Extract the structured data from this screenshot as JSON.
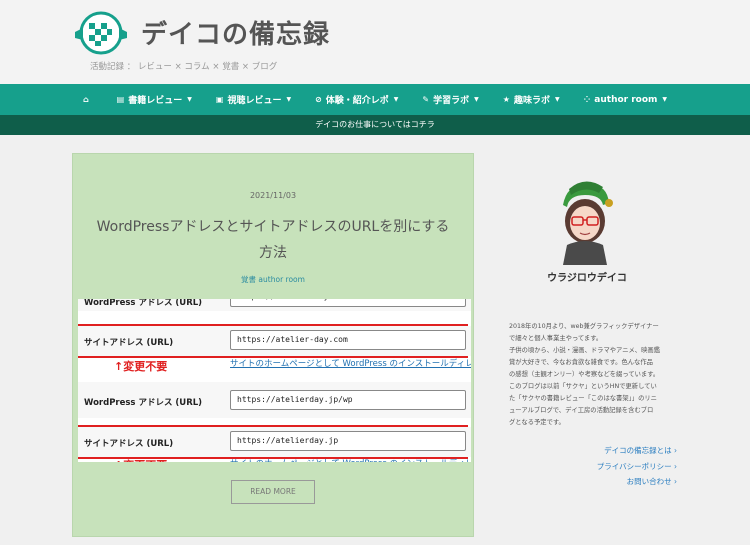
{
  "header": {
    "site_title": "デイコの備忘録",
    "tagline": "活動記録 ： レビュー × コラム × 覚書 × ブログ"
  },
  "nav": {
    "items": [
      {
        "icon": "home-icon",
        "label": ""
      },
      {
        "icon": "book-icon",
        "label": "書籍レビュー"
      },
      {
        "icon": "film-icon",
        "label": "視聴レビュー"
      },
      {
        "icon": "compass-icon",
        "label": "体験・紹介レポ"
      },
      {
        "icon": "pencil-icon",
        "label": "学習ラボ"
      },
      {
        "icon": "star-icon",
        "label": "趣味ラボ"
      },
      {
        "icon": "spinner-icon",
        "label": "author room"
      }
    ]
  },
  "subbar": {
    "text": "デイコのお仕事についてはコチラ"
  },
  "post": {
    "date": "2021/11/03",
    "title": "WordPressアドレスとサイトアドレスのURLを別にする方法",
    "category": "覚書 author room",
    "read_more": "READ MORE"
  },
  "screenshot": {
    "rows": [
      {
        "label": "WordPress アドレス (URL)",
        "value": "https://atelier-day.com"
      },
      {
        "label": "サイトアドレス (URL)",
        "value": "https://atelier-day.com"
      },
      {
        "label": "WordPress アドレス (URL)",
        "value": "https://atelierday.jp/wp"
      },
      {
        "label": "サイトアドレス (URL)",
        "value": "https://atelierday.jp"
      }
    ],
    "help_text": "サイトのホームページとして WordPress のインストールディレクトリとは",
    "note": "↑変更不要"
  },
  "sidebar": {
    "name": "ウラジロウデイコ",
    "bio": [
      "2018年の10月より、web兼グラフィックデザイナー",
      "で細々と個人事業主やってます。",
      "子供の頃から、小説・漫画、ドラマやアニメ、映画鑑",
      "賞が大好きで、今なお貪欲な雑食です。色んな作品",
      "の感想（主観オンリー）や考察などを綴っています。",
      "このブログは以前「サクヤ」というHNで更新してい",
      "た「サクヤの書籍レビュー「このはな書架」」のリニ",
      "ューアルブログで、デイ工房の活動記録を含むブロ",
      "グとなる予定です。"
    ],
    "links": [
      "デイコの備忘録とは ›",
      "プライバシーポリシー ›",
      "お問い合わせ ›"
    ]
  },
  "colors": {
    "nav": "#16a08c",
    "subbar": "#0f5e4a",
    "card": "#c7e2bb",
    "accent_red": "#e02020"
  }
}
